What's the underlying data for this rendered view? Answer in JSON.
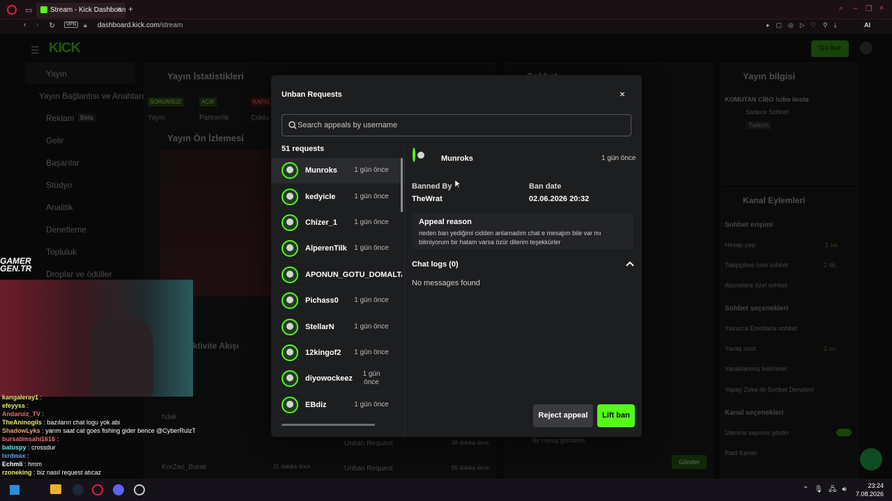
{
  "browser": {
    "tab_title": "Stream - Kick Dashboard",
    "new_tab": "+",
    "vpn": "VPN",
    "url_host": "dashboard.kick.com",
    "url_path": "/stream",
    "ai_label": "AI"
  },
  "dashboard": {
    "logo": "KICK",
    "go_live": "Go live",
    "sidebar": [
      {
        "label": "Yayın"
      },
      {
        "label": "Yayın Bağlantısı ve Anahtarı"
      },
      {
        "label": "Reklam",
        "badge": "Beta"
      },
      {
        "label": "Gelir"
      },
      {
        "label": "Başarılar"
      },
      {
        "label": "Stüdyo"
      },
      {
        "label": "Analitik"
      },
      {
        "label": "Denetleme"
      },
      {
        "label": "Topluluk"
      },
      {
        "label": "Droplar ve ödüller"
      }
    ],
    "stats_title": "Yayın İstatistikleri",
    "stats_pills": [
      "SORUNSUZ",
      "AÇIK",
      "KAPALI"
    ],
    "stats_labels": [
      "Yayın",
      "Partnerlik",
      "Çoklu"
    ],
    "preview_title": "Yayın Ön İzlemesi",
    "chat_title": "Sohbet",
    "info_title": "Yayın bilgisi",
    "info_stream_title": "KOMUTAN CİBO !cibo linsta",
    "info_category": "Sadece Sohbet",
    "info_lang": "Turkish",
    "channel_actions_title": "Kanal Eylemleri",
    "chat_access": "Sohbet erişimi",
    "actions": [
      {
        "label": "Hesap yaşı",
        "value": "1 sa."
      },
      {
        "label": "Takipçilere özel sohbet",
        "value": "2 dk."
      },
      {
        "label": "Abonelere özel sohbet",
        "value": ""
      }
    ],
    "chat_options": "Sohbet seçenekleri",
    "options": [
      {
        "label": "Yalnızca Emotlarla sohbet",
        "value": ""
      },
      {
        "label": "Yavaş mod",
        "value": "2 sn."
      },
      {
        "label": "Yasaklanmış kelimeler",
        "value": ""
      },
      {
        "label": "Yapay Zeka ile Sohbet Denetimi",
        "value": ""
      }
    ],
    "channel_options": "Kanal seçenekleri",
    "ch_opts": [
      "İzlenme sayısını göster",
      "Raid Kanalı"
    ],
    "send_button": "Gönder",
    "chat_placeholder": "Bir mesaj gönderin",
    "activity_title": "Aktivite Akışı",
    "unban_req_1": "Unban Request",
    "unban_req_1_time": "38 dakika önce",
    "unban_req_2": "Unban Request",
    "unban_req_2_time": "55 dakika önce",
    "korzao": "KorZao_Burak",
    "korzao_time": "21 dakika önce",
    "hdak": "hdak"
  },
  "modal": {
    "title": "Unban Requests",
    "close": "×",
    "search_placeholder": "Search appeals by username",
    "count": "51 requests",
    "items": [
      {
        "name": "Munroks",
        "time": "1 gün önce"
      },
      {
        "name": "kedyicle",
        "time": "1 gün önce"
      },
      {
        "name": "Chizer_1",
        "time": "1 gün önce"
      },
      {
        "name": "AlperenTilk",
        "time": "1 gün önce"
      },
      {
        "name": "APONUN_GOTU_DOMALTA",
        "time": ""
      },
      {
        "name": "Pichass0",
        "time": "1 gün önce"
      },
      {
        "name": "StellarN",
        "time": "1 gün önce"
      },
      {
        "name": "12kingof2",
        "time": "1 gün önce"
      },
      {
        "name": "diyowockeez",
        "time": "1 gün önce"
      },
      {
        "name": "EBdiz",
        "time": "1 gün önce"
      }
    ],
    "detail": {
      "name": "Munroks",
      "time": "1 gün önce",
      "banned_by_label": "Banned By",
      "banned_by": "TheWrat",
      "ban_date_label": "Ban date",
      "ban_date": "02.06.2026 20:32",
      "appeal_reason_label": "Appeal reason",
      "appeal_reason": "neden ban yediğimi cidden anlamadım chat e mesajım bile var mı bilmiyorum bir hatam varsa özür dilerim teşekkürler",
      "chat_logs_label": "Chat logs (0)",
      "no_messages": "No messages found"
    },
    "reject_label": "Reject appeal",
    "lift_label": "Lift ban"
  },
  "overlay_chat": [
    {
      "name": "kangaleray1",
      "msg": ":"
    },
    {
      "name": "efeyyss",
      "msg": ":"
    },
    {
      "name": "Andaruiz_TV",
      "msg": ":"
    },
    {
      "name": "TheAninogils",
      "msg": ": bazıların chat logu yok abi"
    },
    {
      "name": "ShadowLyks",
      "msg": ": yarım saat cat goes fishing gider bence @CyberRulzTv"
    },
    {
      "name": "bursatimsahi1616",
      "msg": ":"
    },
    {
      "name": "batuspy",
      "msg": ": crossdur"
    },
    {
      "name": "lxrdwax",
      "msg": ":"
    },
    {
      "name": "Echmli",
      "msg": ": hmm"
    },
    {
      "name": "rzoneking",
      "msg": ": biz nasıl request atıcaz"
    }
  ],
  "webcam_logo": "GAMER GEN.TR",
  "taskbar": {
    "time": "23:24",
    "date": "7.08.2026"
  },
  "colors": {
    "accent": "#53fc18",
    "modal_bg": "#1d1e20",
    "selected_row": "#2a2b2e"
  }
}
